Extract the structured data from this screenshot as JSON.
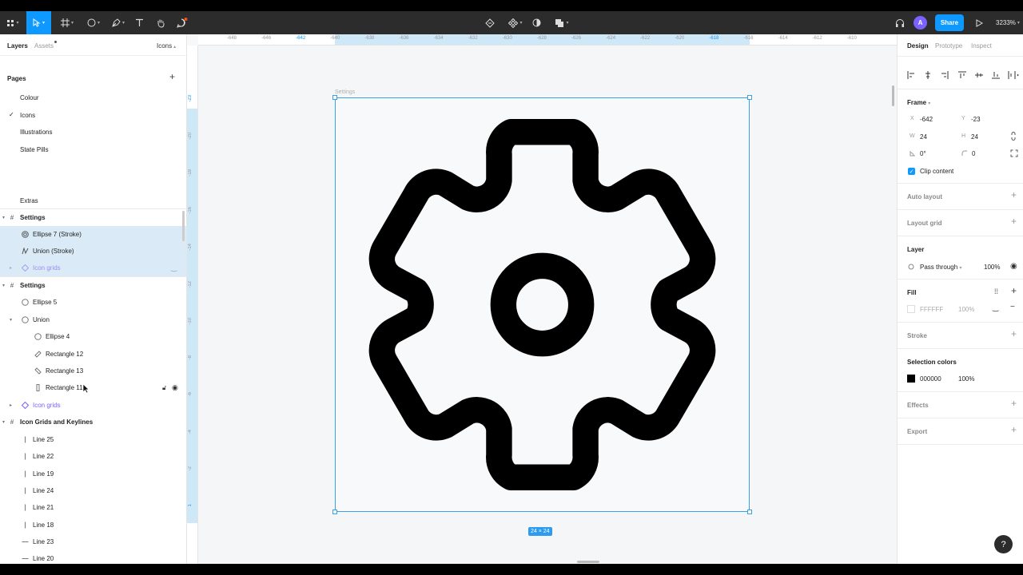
{
  "toolbar": {
    "share_label": "Share",
    "avatar_initial": "A",
    "zoom_level": "3233%"
  },
  "left_panel": {
    "tabs": {
      "layers": "Layers",
      "assets": "Assets",
      "page_selector": "Icons"
    },
    "pages_header": "Pages",
    "pages": [
      "Colour",
      "Icons",
      "Illustrations",
      "State Pills",
      "Extras"
    ],
    "current_page": "Icons",
    "layers": [
      {
        "label": "Settings",
        "kind": "frame"
      },
      {
        "label": "Ellipse 7 (Stroke)",
        "kind": "stroke-ellipse"
      },
      {
        "label": "Union (Stroke)",
        "kind": "stroke-union"
      },
      {
        "label": "Icon grids",
        "kind": "component-faded"
      },
      {
        "label": "Settings",
        "kind": "frame"
      },
      {
        "label": "Ellipse 5",
        "kind": "ellipse"
      },
      {
        "label": "Union",
        "kind": "union"
      },
      {
        "label": "Ellipse 4",
        "kind": "ellipse"
      },
      {
        "label": "Rectangle 12",
        "kind": "rect"
      },
      {
        "label": "Rectangle 13",
        "kind": "rect"
      },
      {
        "label": "Rectangle 11",
        "kind": "rect"
      },
      {
        "label": "Icon grids",
        "kind": "component"
      },
      {
        "label": "Icon Grids and Keylines",
        "kind": "frame"
      },
      {
        "label": "Line 25",
        "kind": "line"
      },
      {
        "label": "Line 22",
        "kind": "line"
      },
      {
        "label": "Line 19",
        "kind": "line"
      },
      {
        "label": "Line 24",
        "kind": "line"
      },
      {
        "label": "Line 21",
        "kind": "line"
      },
      {
        "label": "Line 18",
        "kind": "line"
      },
      {
        "label": "Line 23",
        "kind": "line"
      },
      {
        "label": "Line 20",
        "kind": "line"
      }
    ]
  },
  "rulers": {
    "horizontal": [
      "-648",
      "-646",
      "-642",
      "-640",
      "-638",
      "-636",
      "-634",
      "-632",
      "-630",
      "-628",
      "-626",
      "-624",
      "-622",
      "-620",
      "-618",
      "-616",
      "-614",
      "-612",
      "-610"
    ],
    "vertical": [
      "-23",
      "-20",
      "-18",
      "-16",
      "-14",
      "-12",
      "-10",
      "-8",
      "-6",
      "-4",
      "-2",
      "1"
    ]
  },
  "canvas": {
    "frame_name": "Settings",
    "dimension_label": "24 × 24"
  },
  "right_panel": {
    "tabs": {
      "design": "Design",
      "prototype": "Prototype",
      "inspect": "Inspect"
    },
    "frame_section": "Frame",
    "x_label": "X",
    "x_value": "-642",
    "y_label": "Y",
    "y_value": "-23",
    "w_label": "W",
    "w_value": "24",
    "h_label": "H",
    "h_value": "24",
    "rotation": "0°",
    "radius": "0",
    "clip_content": "Clip content",
    "auto_layout": "Auto layout",
    "layout_grid": "Layout grid",
    "layer_section": "Layer",
    "blend_mode": "Pass through",
    "layer_opacity": "100%",
    "fill_section": "Fill",
    "fill_hex": "FFFFFF",
    "fill_opacity": "100%",
    "stroke_section": "Stroke",
    "selection_colors": "Selection colors",
    "sel_hex": "000000",
    "sel_opacity": "100%",
    "effects": "Effects",
    "export": "Export"
  },
  "colors": {
    "accent": "#0d99ff",
    "toolbar_bg": "#2c2c2c",
    "selection_row": "#daebf7",
    "selection_color": "#000000"
  },
  "help_label": "?"
}
